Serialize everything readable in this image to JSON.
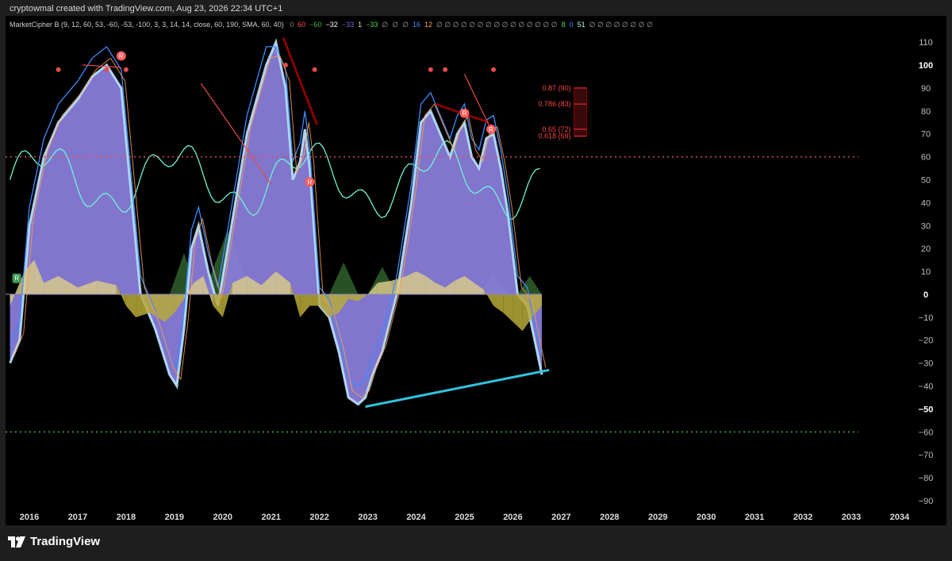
{
  "header": {
    "text": "cryptowmal created with TradingView.com, Aug 23, 2026 22:34 UTC+1"
  },
  "indicator": {
    "name": "MarketCipher B (9, 12, 60, 53, -60, -53, -100, 3, 3, 14, 14, close, 60, 190, SMA, 60, 40)",
    "values": [
      {
        "text": "0",
        "color": "#888888"
      },
      {
        "text": "60",
        "color": "#ff4d4d"
      },
      {
        "text": "−60",
        "color": "#4caf50"
      },
      {
        "text": "−32",
        "color": "#ffffff"
      },
      {
        "text": "−33",
        "color": "#7e6bd6"
      },
      {
        "text": "1",
        "color": "#e6e68a"
      },
      {
        "text": "−33",
        "color": "#4cd964"
      },
      {
        "text": "∅",
        "color": "#aaaaaa"
      },
      {
        "text": "∅",
        "color": "#aaaaaa"
      },
      {
        "text": "∅",
        "color": "#aaaaaa"
      },
      {
        "text": "16",
        "color": "#3d8bff"
      },
      {
        "text": "12",
        "color": "#ff9f43"
      },
      {
        "text": "∅ ∅ ∅ ∅ ∅ ∅ ∅ ∅ ∅ ∅ ∅ ∅ ∅ ∅ ∅",
        "color": "#aaaaaa"
      },
      {
        "text": "8",
        "color": "#4cd964"
      },
      {
        "text": "0",
        "color": "#3d8bff"
      },
      {
        "text": "51",
        "color": "#9fffd8"
      },
      {
        "text": "∅ ∅ ∅ ∅ ∅ ∅ ∅ ∅",
        "color": "#aaaaaa"
      }
    ]
  },
  "chart_data": {
    "type": "area",
    "x_ticks": [
      "2016",
      "2017",
      "2018",
      "2019",
      "2020",
      "2021",
      "2022",
      "2023",
      "2024",
      "2025",
      "2026",
      "2027",
      "2028",
      "2029",
      "2030",
      "2031",
      "2032",
      "2033",
      "2034"
    ],
    "x_range": [
      2015.6,
      2034.7
    ],
    "y_ticks": [
      110,
      100,
      90,
      80,
      70,
      60,
      50,
      40,
      30,
      20,
      10,
      0,
      -10,
      -20,
      -30,
      -40,
      -50,
      -60,
      -70,
      -80,
      -90
    ],
    "y_tick_labels": [
      "110",
      "100",
      "90",
      "80",
      "70",
      "60",
      "50",
      "40",
      "30",
      "20",
      "10",
      "0",
      "−10",
      "−20",
      "−30",
      "−40",
      "−50",
      "−60",
      "−70",
      "−80",
      "−90"
    ],
    "ylim": [
      -94,
      114
    ],
    "bold_levels": [
      100,
      0,
      -50
    ],
    "levels": {
      "overbought": 60,
      "oversold": -60
    },
    "series": [
      {
        "name": "wave",
        "x": [
          2015.6,
          2015.8,
          2016.0,
          2016.3,
          2016.6,
          2017.0,
          2017.3,
          2017.6,
          2017.9,
          2018.1,
          2018.3,
          2018.6,
          2018.9,
          2019.05,
          2019.2,
          2019.35,
          2019.5,
          2019.7,
          2019.9,
          2020.1,
          2020.3,
          2020.5,
          2020.7,
          2020.9,
          2021.1,
          2021.3,
          2021.45,
          2021.6,
          2021.7,
          2021.8,
          2021.9,
          2022.0,
          2022.2,
          2022.4,
          2022.6,
          2022.8,
          2022.95,
          2023.1,
          2023.3,
          2023.6,
          2023.9,
          2024.1,
          2024.3,
          2024.5,
          2024.7,
          2024.85,
          2025.0,
          2025.15,
          2025.3,
          2025.45,
          2025.6,
          2025.75,
          2025.9,
          2026.1,
          2026.3,
          2026.45,
          2026.6
        ],
        "values": [
          -30,
          -20,
          30,
          60,
          75,
          85,
          95,
          100,
          90,
          45,
          0,
          -15,
          -35,
          -40,
          -15,
          20,
          30,
          10,
          -5,
          20,
          45,
          70,
          85,
          100,
          110,
          90,
          50,
          58,
          72,
          55,
          25,
          -5,
          -10,
          -25,
          -45,
          -48,
          -45,
          -35,
          -25,
          0,
          40,
          75,
          80,
          70,
          60,
          70,
          75,
          60,
          55,
          68,
          70,
          55,
          35,
          0,
          -5,
          -20,
          -35
        ]
      },
      {
        "name": "money-flow",
        "x": [
          2015.6,
          2015.9,
          2016.1,
          2016.3,
          2016.6,
          2017.0,
          2017.4,
          2017.8,
          2018.0,
          2018.2,
          2018.5,
          2018.8,
          2019.0,
          2019.2,
          2019.4,
          2019.6,
          2019.8,
          2020.0,
          2020.2,
          2020.5,
          2020.8,
          2021.1,
          2021.4,
          2021.6,
          2021.8,
          2022.0,
          2022.2,
          2022.4,
          2022.6,
          2022.8,
          2023.0,
          2023.2,
          2023.5,
          2023.8,
          2024.0,
          2024.2,
          2024.4,
          2024.6,
          2024.8,
          2025.0,
          2025.2,
          2025.4,
          2025.6,
          2025.8,
          2026.0,
          2026.2,
          2026.4,
          2026.6
        ],
        "values": [
          -5,
          10,
          15,
          5,
          8,
          3,
          6,
          4,
          -5,
          -10,
          -8,
          -12,
          -8,
          -2,
          5,
          8,
          -5,
          -10,
          5,
          8,
          4,
          10,
          5,
          -10,
          -5,
          -5,
          -10,
          -8,
          -2,
          -3,
          0,
          5,
          6,
          8,
          10,
          8,
          5,
          3,
          6,
          8,
          5,
          2,
          -5,
          -8,
          -12,
          -16,
          -10,
          -5
        ]
      }
    ],
    "trendline_bottom": {
      "x": [
        2022.95,
        2026.75
      ],
      "values": [
        -49,
        -33
      ]
    },
    "fibonacci": [
      {
        "label": "0.87 (90)",
        "value": 90
      },
      {
        "label": "0.786 (83)",
        "value": 83
      },
      {
        "label": "0.65 (72)",
        "value": 72
      },
      {
        "label": "0.618 (69)",
        "value": 69
      }
    ]
  },
  "footer": {
    "logo_text": "TradingView"
  },
  "colors": {
    "background": "#000000",
    "frame": "#1e1e1e",
    "wave_fill": "#8c7fe0",
    "wave_edge": "#b9e5ff",
    "mf_pos": "#d7c98a",
    "mf_neg": "#b9aa3a",
    "green_zone": "#2e5a2a",
    "trendline": "#2fc4e0",
    "fib_label": "#ff4444",
    "axis_text": "#bdbdbd",
    "rsi_line": "#6df5d4"
  }
}
